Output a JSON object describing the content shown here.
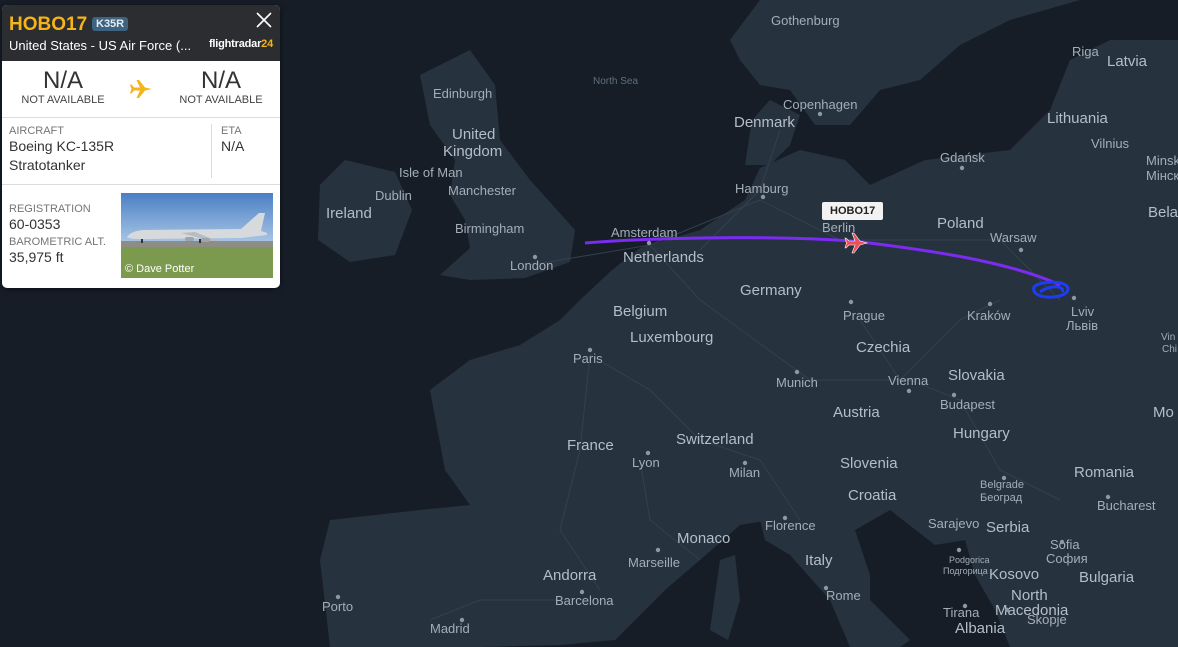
{
  "flight": {
    "callsign": "HOBO17",
    "type_code": "K35R",
    "operator": "United States - US Air Force (...",
    "brand_main": "flightradar",
    "brand_num": "24",
    "origin_code": "N/A",
    "origin_status": "NOT AVAILABLE",
    "dest_code": "N/A",
    "dest_status": "NOT AVAILABLE",
    "aircraft_label": "AIRCRAFT",
    "aircraft_line1": "Boeing KC-135R",
    "aircraft_line2": "Stratotanker",
    "eta_label": "ETA",
    "eta_value": "N/A",
    "registration_label": "REGISTRATION",
    "registration_value": "60-0353",
    "alt_label": "BAROMETRIC ALT.",
    "alt_value": "35,975 ft",
    "photo_credit": "© Dave Potter"
  },
  "map": {
    "aircraft_tag": "HOBO17",
    "colors": {
      "track": "#7a2cf0",
      "track_end": "#1f3cf5",
      "aircraft_marker": "#e8505b",
      "brand_accent": "#f4b41a"
    },
    "seas": [
      "North Sea"
    ],
    "countries": [
      "Latvia",
      "Denmark",
      "Lithuania",
      "United Kingdom",
      "Ireland",
      "Poland",
      "Belarus",
      "Netherlands",
      "Germany",
      "Belgium",
      "Luxembourg",
      "Czechia",
      "Slovakia",
      "Austria",
      "Hungary",
      "France",
      "Switzerland",
      "Slovenia",
      "Croatia",
      "Romania",
      "Serbia",
      "Monaco",
      "Italy",
      "Andorra",
      "Kosovo",
      "Bulgaria",
      "North Macedonia",
      "Albania",
      "Moldova"
    ],
    "cities": [
      "Gothenburg",
      "Riga",
      "Edinburgh",
      "Copenhagen",
      "Vilnius",
      "Minsk",
      "Мінск",
      "Isle of Man",
      "Gdańsk",
      "Dublin",
      "Manchester",
      "Hamburg",
      "Birmingham",
      "Amsterdam",
      "Berlin",
      "Warsaw",
      "London",
      "Lviv",
      "Львів",
      "Prague",
      "Kraków",
      "Paris",
      "Munich",
      "Vienna",
      "Budapest",
      "Lyon",
      "Milan",
      "Belgrade",
      "Београд",
      "Florence",
      "Sarajevo",
      "Bucharest",
      "Marseille",
      "Sofia",
      "София",
      "Podgorica",
      "Подгорица",
      "Porto",
      "Barcelona",
      "Rome",
      "Tirana",
      "Skopje",
      "Madrid",
      "Vin",
      "Chi"
    ]
  }
}
